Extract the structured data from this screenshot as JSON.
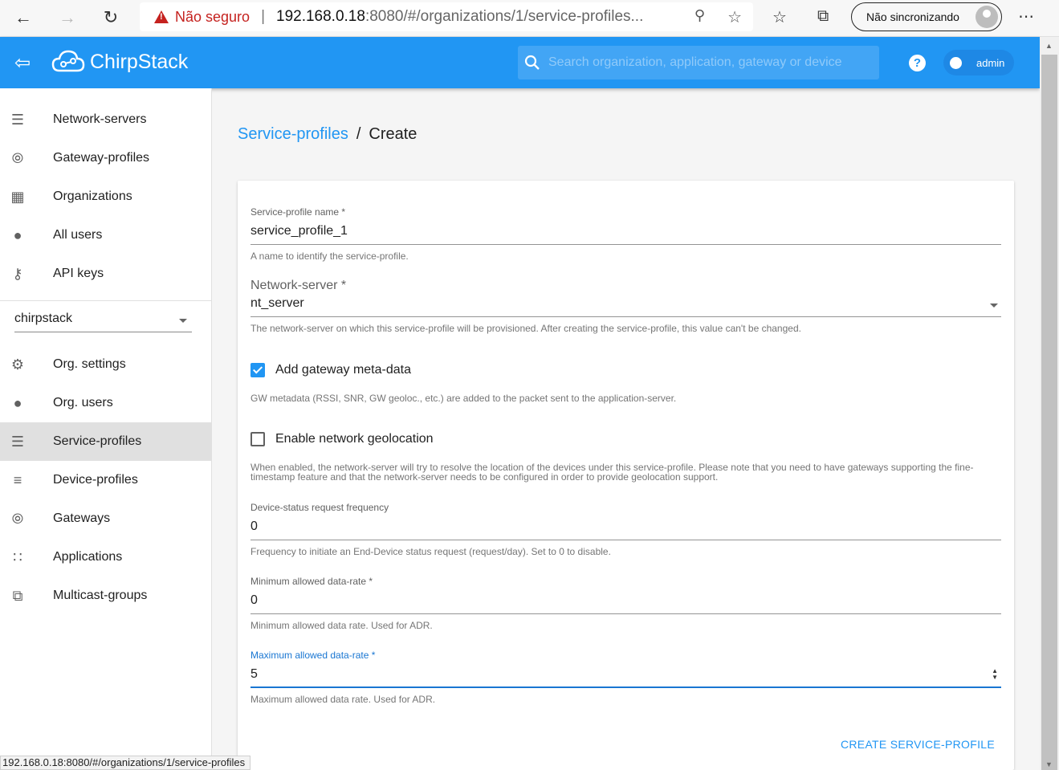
{
  "browser": {
    "security": "Não seguro",
    "url_host": "192.168.0.18",
    "url_rest": ":8080/#/organizations/1/service-profiles...",
    "sync_label": "Não sincronizando",
    "status_url": "192.168.0.18:8080/#/organizations/1/service-profiles"
  },
  "header": {
    "brand": "ChirpStack",
    "search_placeholder": "Search organization, application, gateway or device",
    "user": "admin"
  },
  "sidebar": {
    "global_items": [
      {
        "label": "Network-servers",
        "icon": "server-icon"
      },
      {
        "label": "Gateway-profiles",
        "icon": "radio-tower-icon"
      },
      {
        "label": "Organizations",
        "icon": "domain-icon"
      },
      {
        "label": "All users",
        "icon": "person-icon"
      },
      {
        "label": "API keys",
        "icon": "key-icon"
      }
    ],
    "org_selected": "chirpstack",
    "org_items": [
      {
        "label": "Org. settings",
        "icon": "gear-icon"
      },
      {
        "label": "Org. users",
        "icon": "person-icon"
      },
      {
        "label": "Service-profiles",
        "icon": "account-details-icon"
      },
      {
        "label": "Device-profiles",
        "icon": "tune-icon"
      },
      {
        "label": "Gateways",
        "icon": "radio-tower-icon"
      },
      {
        "label": "Applications",
        "icon": "apps-icon"
      },
      {
        "label": "Multicast-groups",
        "icon": "rss-icon"
      }
    ]
  },
  "breadcrumb": {
    "parent": "Service-profiles",
    "separator": "/",
    "current": "Create"
  },
  "form": {
    "name": {
      "label": "Service-profile name *",
      "value": "service_profile_1",
      "help": "A name to identify the service-profile."
    },
    "network_server": {
      "label": "Network-server *",
      "value": "nt_server",
      "help": "The network-server on which this service-profile will be provisioned. After creating the service-profile, this value can't be changed."
    },
    "gw_metadata": {
      "label": "Add gateway meta-data",
      "checked": true,
      "help": "GW metadata (RSSI, SNR, GW geoloc., etc.) are added to the packet sent to the application-server."
    },
    "geolocation": {
      "label": "Enable network geolocation",
      "checked": false,
      "help": "When enabled, the network-server will try to resolve the location of the devices under this service-profile. Please note that you need to have gateways supporting the fine-timestamp feature and that the network-server needs to be configured in order to provide geolocation support."
    },
    "dev_status_freq": {
      "label": "Device-status request frequency",
      "value": "0",
      "help": "Frequency to initiate an End-Device status request (request/day). Set to 0 to disable."
    },
    "min_dr": {
      "label": "Minimum allowed data-rate *",
      "value": "0",
      "help": "Minimum allowed data rate. Used for ADR."
    },
    "max_dr": {
      "label": "Maximum allowed data-rate *",
      "value": "5",
      "help": "Maximum allowed data rate. Used for ADR."
    },
    "submit": "CREATE SERVICE-PROFILE"
  },
  "colors": {
    "primary": "#2196f3",
    "focus": "#1976d2"
  }
}
